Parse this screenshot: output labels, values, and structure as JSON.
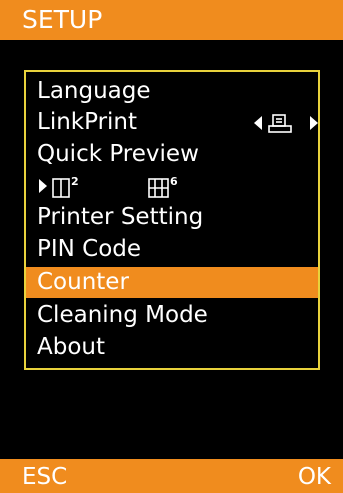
{
  "header": {
    "title": "SETUP"
  },
  "menu": {
    "items": [
      {
        "label": "Language"
      },
      {
        "label": "LinkPrint"
      },
      {
        "label": "Quick Preview"
      },
      {
        "label": ""
      },
      {
        "label": "Printer Setting"
      },
      {
        "label": "PIN Code"
      },
      {
        "label": "Counter"
      },
      {
        "label": "Cleaning Mode"
      },
      {
        "label": "About"
      }
    ],
    "selected": "Counter"
  },
  "quick_preview": {
    "option_1_count": "2",
    "option_2_count": "6"
  },
  "footer": {
    "esc_label": "ESC",
    "ok_label": "OK"
  },
  "colors": {
    "accent": "#f08c1e",
    "frame": "#e8d23c",
    "background": "#000000",
    "text": "#ffffff"
  },
  "icons": {
    "linkprint_value": "printer-icon",
    "left_arrow": "left-arrow-icon",
    "right_arrow": "right-arrow-icon"
  }
}
